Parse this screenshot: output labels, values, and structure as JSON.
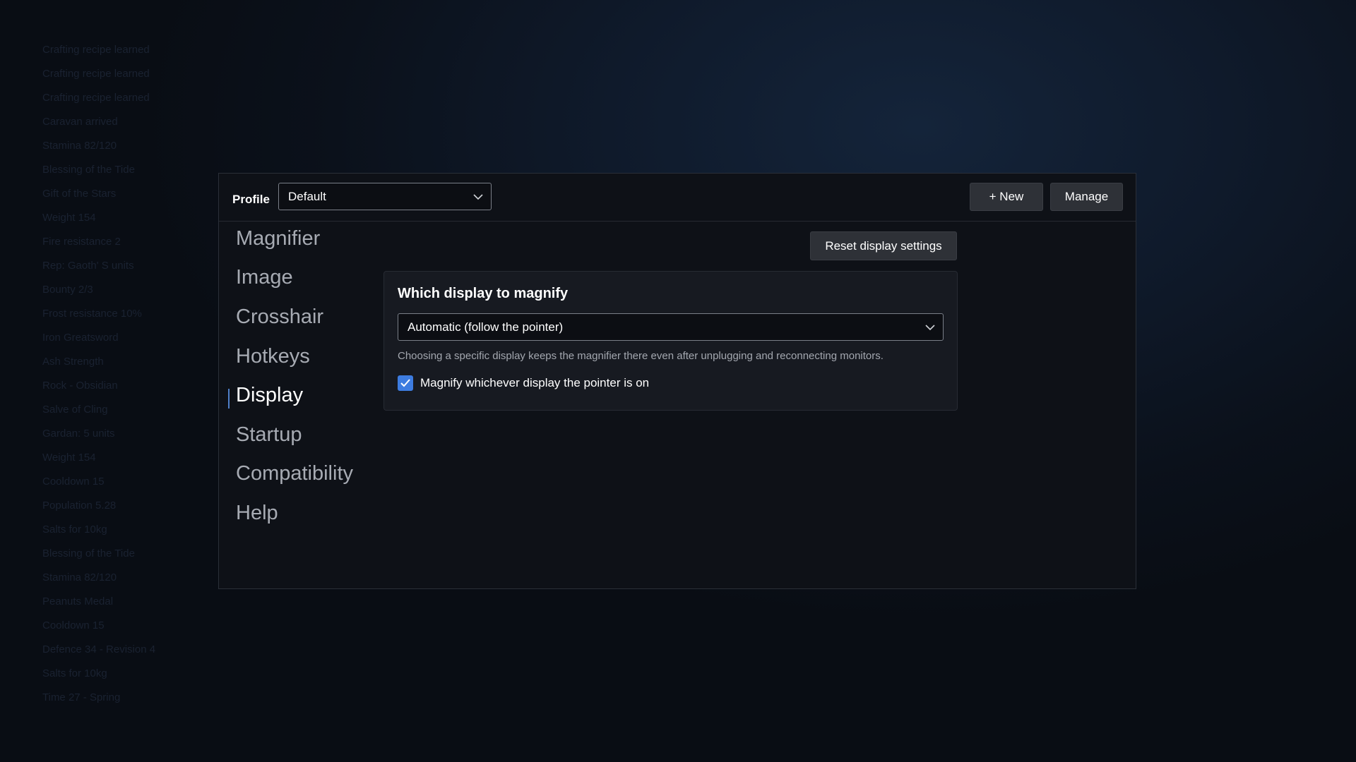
{
  "background": {
    "log_lines": [
      "Crafting recipe learned",
      "Crafting recipe learned",
      "Crafting recipe learned",
      "Caravan arrived",
      "Stamina 82/120",
      "Blessing of the Tide",
      "Gift of the Stars",
      "Weight 154",
      "Fire resistance 2",
      "Rep: Gaoth' S units",
      "Bounty 2/3",
      "Frost resistance 10%",
      "Iron Greatsword",
      "Ash Strength",
      "Rock - Obsidian",
      "Salve of Cling",
      "Gardan: 5 units",
      "Weight 154",
      "Cooldown 15",
      "Population 5.28",
      "Salts for 10kg",
      "Blessing of the Tide",
      "Stamina 82/120",
      "Peanuts Medal",
      "Cooldown 15",
      "Defence 34 - Revision 4",
      "Salts for 10kg",
      "Time 27 - Spring"
    ]
  },
  "topbar": {
    "profile_label": "Profile",
    "profile_value": "Default",
    "new_label": "+ New",
    "manage_label": "Manage"
  },
  "sidebar": {
    "items": [
      {
        "label": "Magnifier"
      },
      {
        "label": "Image"
      },
      {
        "label": "Crosshair"
      },
      {
        "label": "Hotkeys"
      },
      {
        "label": "Display"
      },
      {
        "label": "Startup"
      },
      {
        "label": "Compatibility"
      },
      {
        "label": "Help"
      }
    ],
    "active": "Display"
  },
  "main": {
    "reset_label": "Reset display settings",
    "card": {
      "title": "Which display to magnify",
      "select_value": "Automatic (follow the pointer)",
      "help_text": "Choosing a specific display keeps the magnifier there even after unplugging and reconnecting monitors.",
      "checkbox_label": "Magnify whichever display the pointer is on",
      "checkbox_checked": true
    }
  },
  "colors": {
    "accent": "#3d7ce0",
    "window_bg": "#0e1117",
    "card_bg": "#171a21",
    "button_bg": "#2e3137"
  },
  "icons": {
    "select_arrow": "chevron-down-icon",
    "checkbox_mark": "checkmark-icon"
  }
}
